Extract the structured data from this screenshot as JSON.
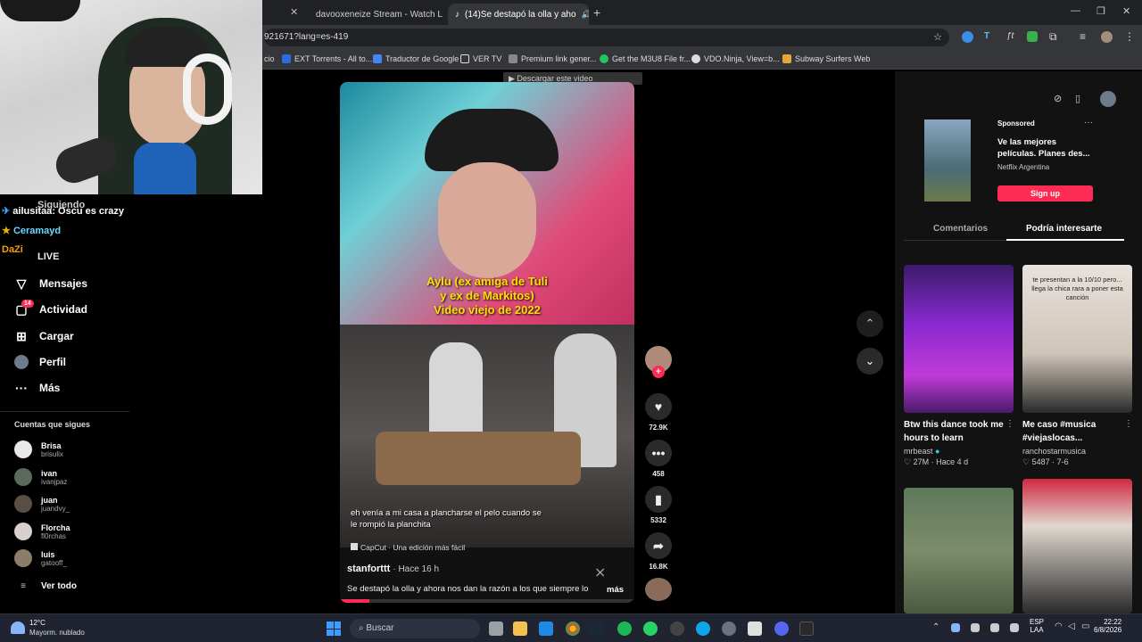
{
  "browser": {
    "tabs": [
      {
        "title": "davooxeneize Stream - Watch L"
      },
      {
        "title": "(14)Se destapó la olla y aho"
      }
    ],
    "url": "921671?lang=es-419",
    "bookmarks": [
      {
        "label": "cio"
      },
      {
        "label": "EXT Torrents - All to..."
      },
      {
        "label": "Traductor de Google"
      },
      {
        "label": "VER TV"
      },
      {
        "label": "Premium link gener..."
      },
      {
        "label": "Get the M3U8 File fr..."
      },
      {
        "label": "VDO.Ninja, View=b..."
      },
      {
        "label": "Subway Surfers Web"
      }
    ],
    "download_banner": "Descargar este video"
  },
  "chat": [
    {
      "user": "ailusitaa",
      "message": ": Oscu es crazy"
    },
    {
      "user": "Ceramayd",
      "message": ""
    },
    {
      "user": "DaZi",
      "message": ""
    }
  ],
  "sidebar": {
    "following_label": "Siguiendo",
    "live_label": "LIVE",
    "items": [
      {
        "label": "Mensajes",
        "icon": "send-icon"
      },
      {
        "label": "Actividad",
        "icon": "activity-icon",
        "badge": "14"
      },
      {
        "label": "Cargar",
        "icon": "upload-icon"
      },
      {
        "label": "Perfil",
        "icon": "profile-icon"
      },
      {
        "label": "Más",
        "icon": "more-icon"
      }
    ],
    "following_header": "Cuentas que sigues",
    "accounts": [
      {
        "name": "Brisa",
        "user": "brisulix"
      },
      {
        "name": "ivan",
        "user": "ivanjpaz"
      },
      {
        "name": "juan",
        "user": "juandvy_"
      },
      {
        "name": "Florcha",
        "user": "fl0rchas"
      },
      {
        "name": "luis",
        "user": "gatooff_"
      }
    ],
    "see_all": "Ver todo"
  },
  "video": {
    "top_caption_lines": [
      "Aylu (ex amiga de Tuli",
      "y ex de Markitos)",
      "Video viejo de 2022"
    ],
    "subtitle_lines": [
      "eh venía a mi casa a plancharse el pelo cuando se",
      "le rompió la planchita"
    ],
    "capcut": "CapCut · Una edición más fácil",
    "author": "stanforttt",
    "time": "· Hace 16 h",
    "description": "Se destapó la olla y ahora nos dan la razón a los que siempre lo",
    "more": "más",
    "progress": 0.1,
    "likes": "72.9K",
    "comments": "458",
    "saves": "5332",
    "shares": "16.8K"
  },
  "right_panel": {
    "sponsored_label": "Sponsored",
    "ad_title": "Ve las mejores películas. Planes des...",
    "ad_brand": "Netflix Argentina",
    "ad_button": "Sign up",
    "tab_comments": "Comentarios",
    "tab_suggested": "Podría interesarte",
    "cards": [
      {
        "title": "Btw this dance took me hours to learn",
        "author": "mrbeast",
        "stats": "♡ 27M · Hace 4 d",
        "overlay": ""
      },
      {
        "title": "Me caso #musica #viejaslocas...",
        "author": "ranchostarmusica",
        "stats": "♡ 5487 · 7-6",
        "overlay": "te presentan a la 10/10 pero... llega la chica rara a poner esta canción"
      }
    ]
  },
  "taskbar": {
    "weather_temp": "12°C",
    "weather_desc": "Mayorm. nublado",
    "search_placeholder": "Buscar",
    "lang": "ESP",
    "lang2": "LAA",
    "time": "22:22",
    "date": "6/8/2026"
  },
  "colors": {
    "accent": "#fe2c55",
    "panel": "#121212"
  }
}
